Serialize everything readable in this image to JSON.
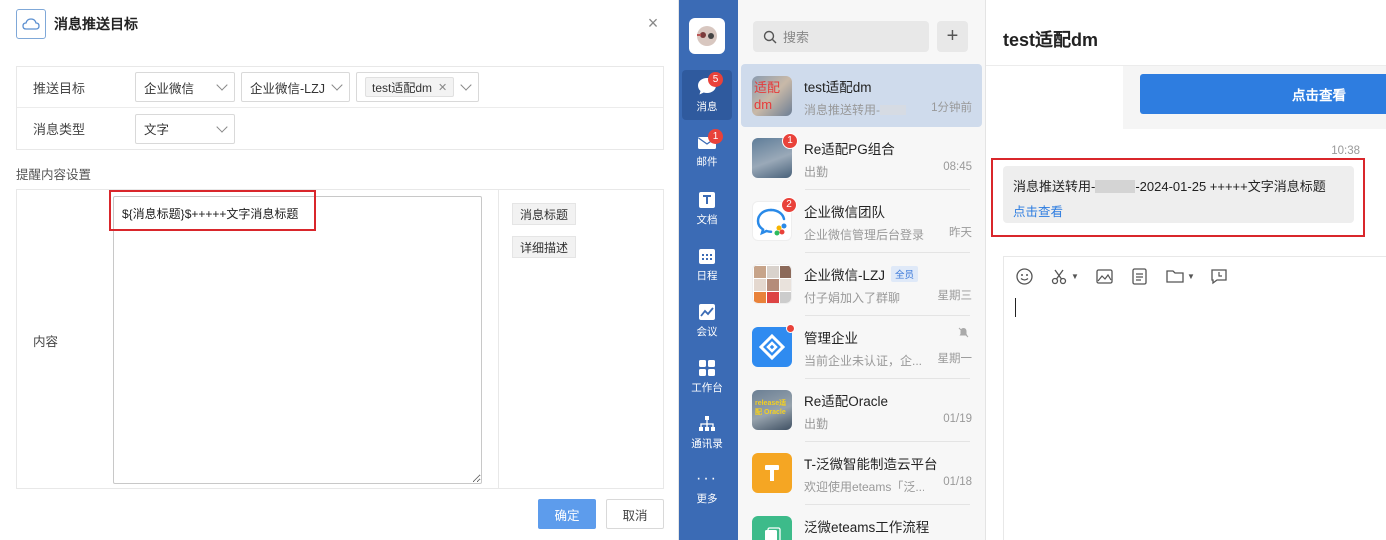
{
  "dialog": {
    "title": "消息推送目标",
    "fields": {
      "target_label": "推送目标",
      "target_type": "企业微信",
      "target_app": "企业微信-LZJ",
      "target_tag": "test适配dm",
      "msg_type_label": "消息类型",
      "msg_type_value": "文字"
    },
    "section_title": "提醒内容设置",
    "content_label": "内容",
    "content_value": "${消息标题}$+++++文字消息标题",
    "variables": [
      "消息标题",
      "详细描述"
    ],
    "ok_label": "确定",
    "cancel_label": "取消"
  },
  "rail": {
    "items": [
      {
        "label": "消息",
        "badge": "5",
        "icon": "chat-bubble-icon"
      },
      {
        "label": "邮件",
        "badge": "1",
        "icon": "mail-icon"
      },
      {
        "label": "文档",
        "badge": "",
        "icon": "document-icon"
      },
      {
        "label": "日程",
        "badge": "",
        "icon": "calendar-icon"
      },
      {
        "label": "会议",
        "badge": "",
        "icon": "meeting-icon"
      },
      {
        "label": "工作台",
        "badge": "",
        "icon": "workbench-icon"
      },
      {
        "label": "通讯录",
        "badge": "",
        "icon": "contacts-icon"
      },
      {
        "label": "更多",
        "badge": "",
        "icon": "more-icon"
      }
    ]
  },
  "conversations": {
    "search_placeholder": "搜索",
    "avatar_texts": {
      "test": "适配dm",
      "oracle": "release适配 Oracle"
    },
    "items": [
      {
        "name": "test适配dm",
        "preview": "消息推送转用-",
        "time": "1分钟前",
        "badge": ""
      },
      {
        "name": "Re适配PG组合",
        "preview": "出勤",
        "time": "08:45",
        "badge": "1"
      },
      {
        "name": "企业微信团队",
        "preview": "企业微信管理后台登录...",
        "time": "昨天",
        "badge": "2"
      },
      {
        "name": "企业微信-LZJ",
        "tag": "全员",
        "preview": "付子娟加入了群聊",
        "time": "星期三",
        "badge": ""
      },
      {
        "name": "管理企业",
        "preview": "当前企业未认证，企...",
        "time": "星期一",
        "badge": ""
      },
      {
        "name": "Re适配Oracle",
        "preview": "出勤",
        "time": "01/19",
        "badge": ""
      },
      {
        "name": "T-泛微智能制造云平台",
        "preview": "欢迎使用eteams「泛...",
        "time": "01/18",
        "badge": ""
      },
      {
        "name": "泛微eteams工作流程",
        "preview": "",
        "time": "",
        "badge": ""
      }
    ]
  },
  "chat": {
    "title": "test适配dm",
    "card_button": "点击查看",
    "msg_time": "10:38",
    "msg_prefix": "消息推送转用-",
    "msg_suffix": "-2024-01-25 +++++文字消息标题",
    "msg_link": "点击查看"
  },
  "colors": {
    "rail_bg": "#3b6bb5",
    "primary": "#2e7de0",
    "highlight_red": "#d9262b",
    "badge_red": "#e9423a"
  }
}
